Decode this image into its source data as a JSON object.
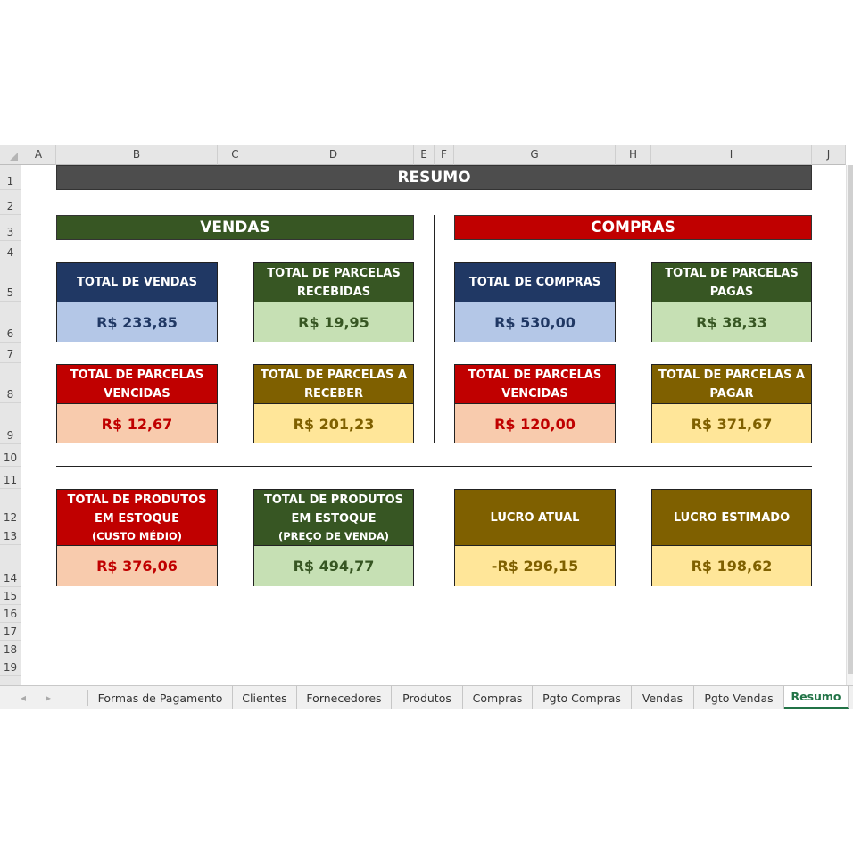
{
  "columns": [
    "A",
    "B",
    "C",
    "D",
    "E",
    "F",
    "G",
    "H",
    "I",
    "J"
  ],
  "rows": [
    "1",
    "2",
    "3",
    "4",
    "5",
    "6",
    "7",
    "8",
    "9",
    "10",
    "11",
    "12",
    "13",
    "14",
    "15",
    "16",
    "17",
    "18",
    "19"
  ],
  "title": "RESUMO",
  "colors": {
    "title_band": "#4d4d4d",
    "vendas_band": "#375623",
    "compras_band": "#c00000",
    "navy": "#203864",
    "green": "#375623",
    "red": "#c00000",
    "olive": "#7f6000",
    "light_blue": "#b4c7e7",
    "light_green": "#c6e0b4",
    "light_peach": "#f8cbad",
    "light_yellow": "#ffe699"
  },
  "sections": {
    "vendas": "VENDAS",
    "compras": "COMPRAS"
  },
  "vendas": {
    "total_vendas": {
      "title": "TOTAL DE VENDAS",
      "value": "R$ 233,85"
    },
    "parcelas_recebidas": {
      "title_1": "TOTAL DE PARCELAS",
      "title_2": "RECEBIDAS",
      "value": "R$ 19,95"
    },
    "parcelas_vencidas": {
      "title_1": "TOTAL DE PARCELAS",
      "title_2": "VENCIDAS",
      "value": "R$ 12,67"
    },
    "parcelas_a_receber": {
      "title_1": "TOTAL DE PARCELAS A",
      "title_2": "RECEBER",
      "value": "R$ 201,23"
    }
  },
  "compras": {
    "total_compras": {
      "title": "TOTAL DE COMPRAS",
      "value": "R$ 530,00"
    },
    "parcelas_pagas": {
      "title_1": "TOTAL DE PARCELAS",
      "title_2": "PAGAS",
      "value": "R$ 38,33"
    },
    "parcelas_vencidas": {
      "title_1": "TOTAL DE PARCELAS",
      "title_2": "VENCIDAS",
      "value": "R$ 120,00"
    },
    "parcelas_a_pagar": {
      "title_1": "TOTAL DE PARCELAS A",
      "title_2": "PAGAR",
      "value": "R$ 371,67"
    }
  },
  "estoque": {
    "custo": {
      "title_1": "TOTAL DE PRODUTOS",
      "title_2": "EM ESTOQUE",
      "title_3": "(CUSTO MÉDIO)",
      "value": "R$ 376,06"
    },
    "venda": {
      "title_1": "TOTAL DE PRODUTOS",
      "title_2": "EM ESTOQUE",
      "title_3": "(PREÇO DE VENDA)",
      "value": "R$ 494,77"
    }
  },
  "lucro": {
    "atual": {
      "title": "LUCRO ATUAL",
      "value": "-R$ 296,15"
    },
    "estimado": {
      "title": "LUCRO ESTIMADO",
      "value": "R$ 198,62"
    }
  },
  "tabs": [
    "Formas de Pagamento",
    "Clientes",
    "Fornecedores",
    "Produtos",
    "Compras",
    "Pgto Compras",
    "Vendas",
    "Pgto Vendas",
    "Resumo"
  ],
  "active_tab": "Resumo"
}
